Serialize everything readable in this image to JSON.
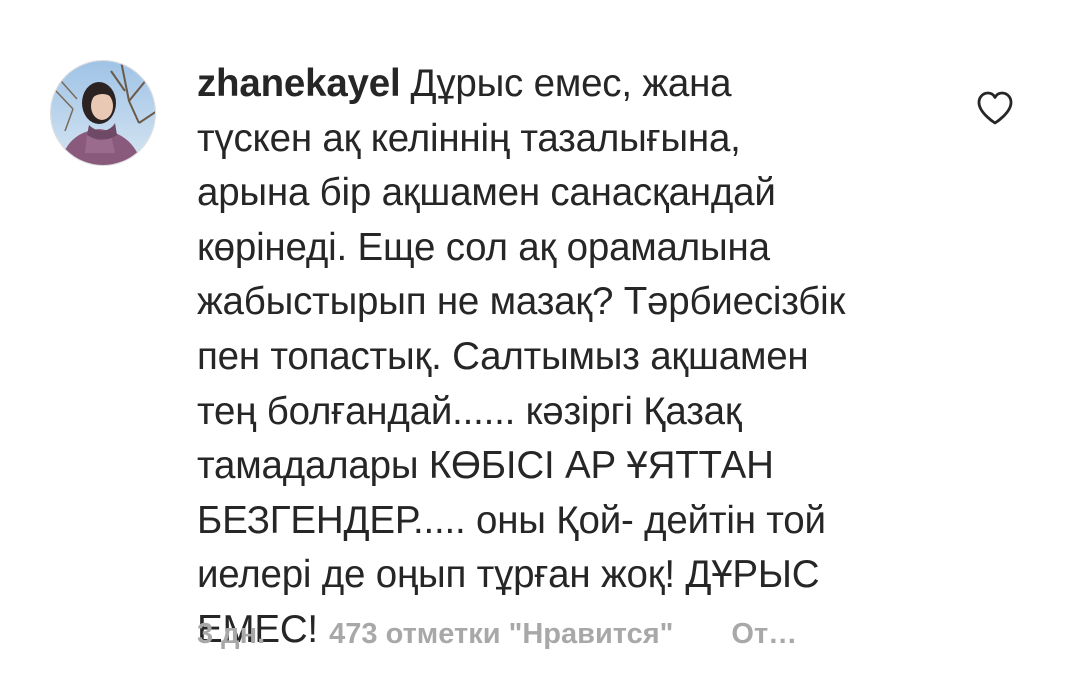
{
  "comment": {
    "username": "zhanekayel",
    "text": "Дұрыс емес, жана\nтүскен ақ келіннің тазалығына,\nарына бір ақшамен санасқандай\nкөрінеді. Еще сол ақ орамалына\nжабыстырып не мазақ? Тәрбиесізбік\nпен топастық. Салтымыз ақшамен\nтең болғандай...... кәзіргі Қазақ\nтамадалары КӨБІСІ АР ҰЯТТАН\nБЕЗГЕНДЕР..... оны Қой- дейтін той\nиелері де оңып тұрған жоқ! ДҰРЫС\nЕМЕС!",
    "time": "3 дн.",
    "likes": "473 отметки \"Нравится\"",
    "reply": "От…"
  },
  "icons": {
    "like": "heart-outline-icon",
    "avatar": "user-avatar-photo"
  },
  "colors": {
    "text": "#262626",
    "meta": "#a8a8a8",
    "background": "#ffffff"
  }
}
